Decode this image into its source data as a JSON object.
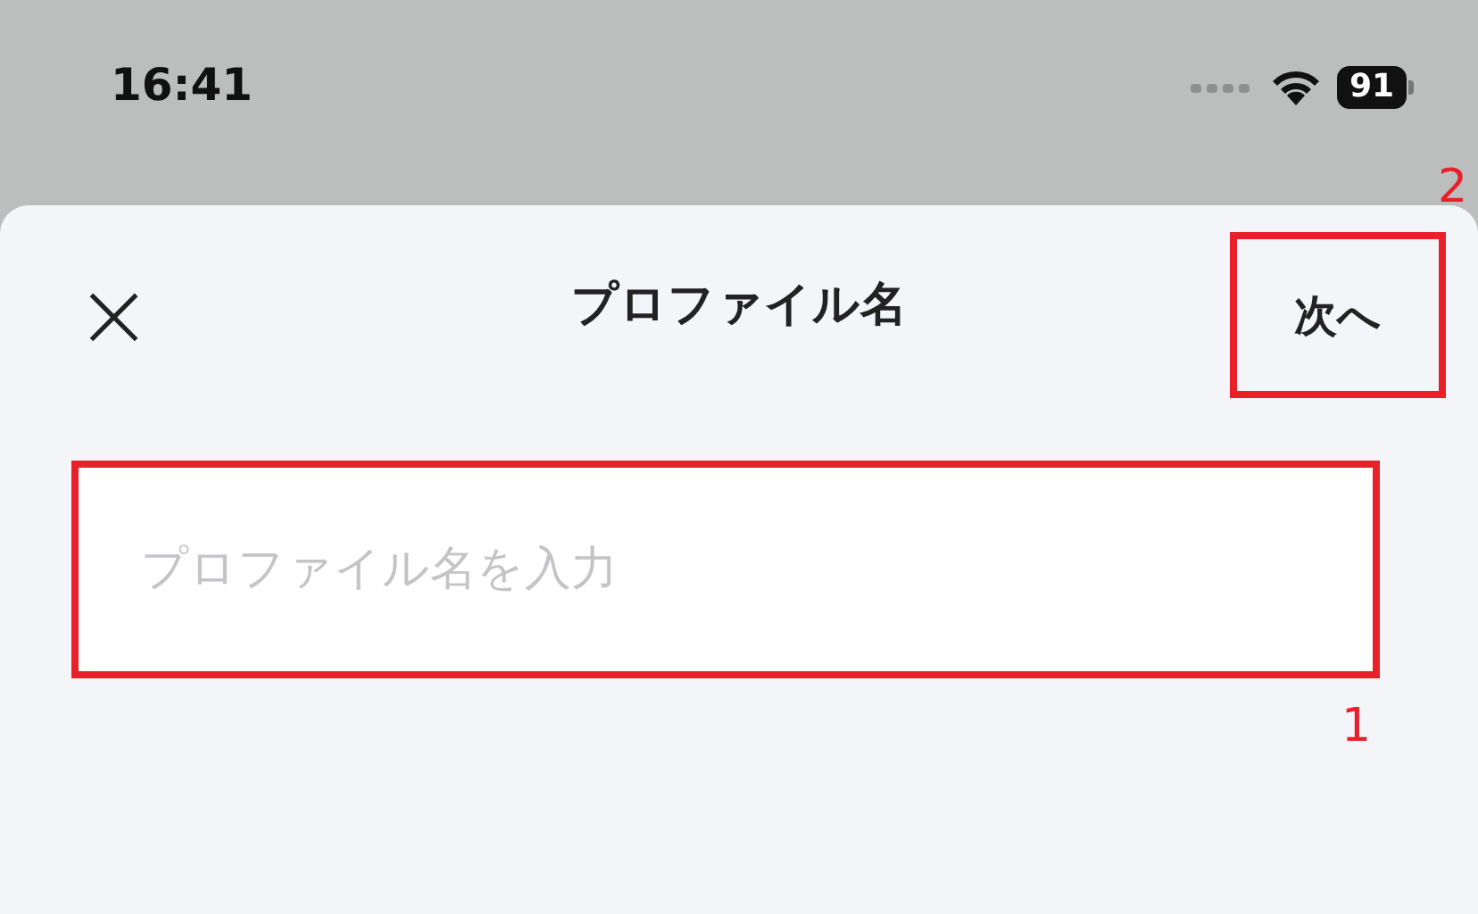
{
  "status_bar": {
    "time": "16:41",
    "battery": "91"
  },
  "header": {
    "close": "×",
    "title": "プロファイル名",
    "next_button": {
      "label": "次へ",
      "annotation": "2"
    }
  },
  "name_field": {
    "placeholder": "プロファイル名を入力",
    "annotation": "1"
  }
}
